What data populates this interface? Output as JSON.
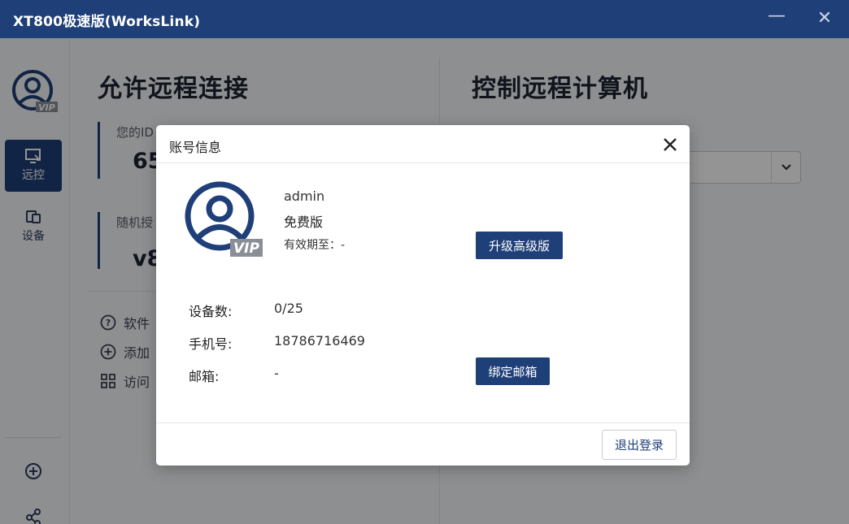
{
  "window": {
    "title": "XT800极速版(WorksLink)",
    "minimize_icon": "minimize-icon",
    "close_icon": "close-icon"
  },
  "sidebar": {
    "avatar_icon": "user-vip-avatar-icon",
    "items": [
      {
        "label": "远控",
        "icon": "remote-monitor-icon",
        "active": true
      },
      {
        "label": "设备",
        "icon": "devices-icon",
        "active": false
      }
    ],
    "bottom_icons": [
      "add-circle-icon",
      "share-icon"
    ]
  },
  "left_panel": {
    "title": "允许远程连接",
    "id_label": "您的ID",
    "id_value": "65",
    "password_label": "随机授",
    "password_value": "v8",
    "links": [
      {
        "label": "软件",
        "icon": "help-circle-icon"
      },
      {
        "label": "添加",
        "icon": "add-circle-icon"
      },
      {
        "label": "访问",
        "icon": "grid-icon"
      }
    ]
  },
  "right_panel": {
    "title": "控制远程计算机"
  },
  "dialog": {
    "title": "账号信息",
    "username": "admin",
    "plan": "免费版",
    "expire": "有效期至：-",
    "upgrade_button": "升级高级版",
    "device_count_label": "设备数:",
    "device_count_value": "0/25",
    "phone_label": "手机号:",
    "phone_value": "18786716469",
    "email_label": "邮箱:",
    "email_value": "-",
    "bind_email_button": "绑定邮箱",
    "logout_button": "退出登录",
    "vip_badge": "VIP"
  },
  "colors": {
    "brand": "#1f3f78",
    "overlay": "rgba(0,0,0,0.42)"
  }
}
